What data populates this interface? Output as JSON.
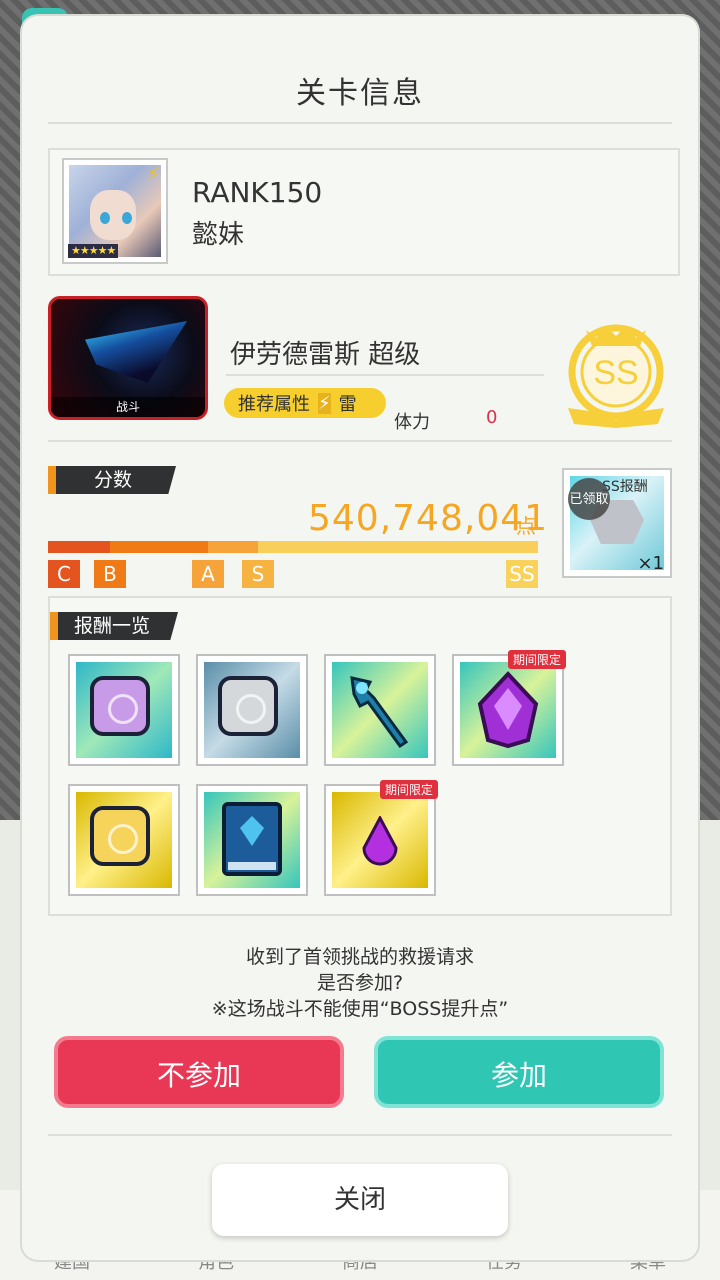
{
  "dialog": {
    "title": "关卡信息"
  },
  "player": {
    "rank": "RANK150",
    "name": "懿妹",
    "stars": "★★★★★"
  },
  "boss": {
    "image_label": "战斗",
    "name": "伊劳德雷斯 超级",
    "recommend_attr_label": "推荐属性",
    "element": "雷",
    "stamina_label": "体力",
    "stamina_value": "0",
    "grade_emblem": "SS"
  },
  "score": {
    "section_label": "分数",
    "value": "540,748,041",
    "unit": "点",
    "grades": [
      "C",
      "B",
      "A",
      "S",
      "SS"
    ],
    "colors": {
      "c": "#e4541f",
      "b": "#f07a15",
      "a": "#f6a33a",
      "s": "#f6b340",
      "ss": "#f8d25a"
    }
  },
  "score_reward": {
    "header": "SS报酬",
    "status": "已领取",
    "quantity": "×1"
  },
  "rewards": {
    "section_label": "报酬一览",
    "limited_tag": "期间限定",
    "items": [
      {
        "icon": "purple-medal-icon"
      },
      {
        "icon": "silver-medal-icon"
      },
      {
        "icon": "lightning-staff-icon"
      },
      {
        "icon": "purple-gem-icon",
        "limited": true
      },
      {
        "icon": "gold-medal-icon"
      },
      {
        "icon": "blue-book-icon"
      },
      {
        "icon": "purple-drop-icon",
        "limited": true
      }
    ]
  },
  "message": {
    "line1": "收到了首领挑战的救援请求",
    "line2": "是否参加?",
    "line3": "※这场战斗不能使用“BOSS提升点”"
  },
  "buttons": {
    "decline": "不参加",
    "join": "参加",
    "close": "关闭"
  },
  "background_nav": [
    "建国",
    "角色",
    "商店",
    "任务",
    "菜单"
  ]
}
